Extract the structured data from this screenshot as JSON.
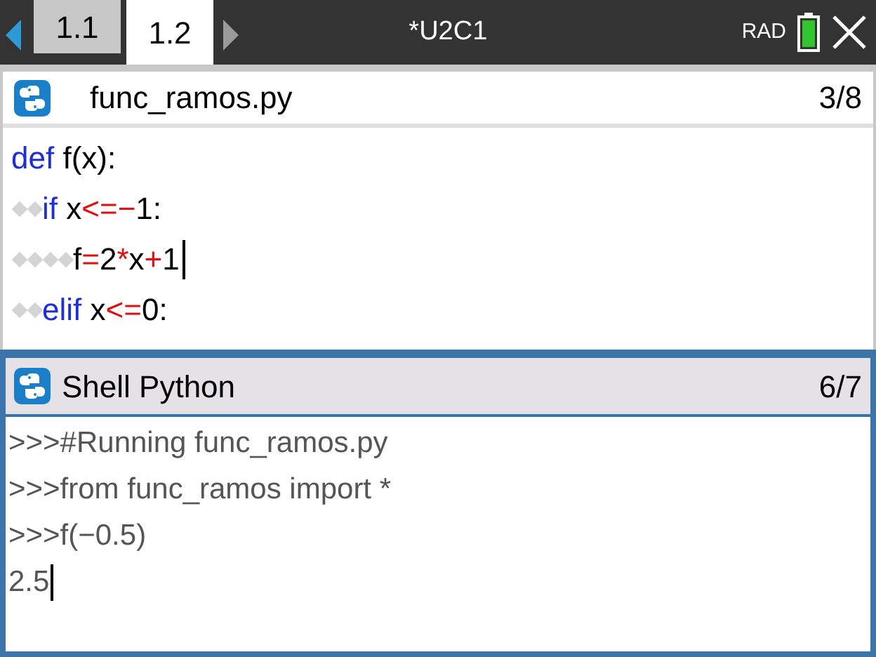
{
  "tabs": [
    {
      "label": "1.1",
      "selected": false
    },
    {
      "label": "1.2",
      "selected": true
    }
  ],
  "document_title": "*U2C1",
  "angle_mode": "RAD",
  "editor": {
    "file_name": "func_ramos.py",
    "position": "3/8",
    "lines": [
      {
        "cursor": false,
        "tokens": [
          {
            "kind": "keyword",
            "text": "def"
          },
          {
            "kind": "name",
            "text": " f(x):"
          }
        ],
        "children": [
          {
            "cursor": false,
            "tokens": [
              {
                "kind": "keyword",
                "text": "if"
              },
              {
                "kind": "name",
                "text": " x"
              },
              {
                "kind": "operator",
                "text": "<=−"
              },
              {
                "kind": "name",
                "text": "1:"
              }
            ],
            "children": [
              {
                "cursor": true,
                "tokens": [
                  {
                    "kind": "name",
                    "text": "f"
                  },
                  {
                    "kind": "operator",
                    "text": "="
                  },
                  {
                    "kind": "name",
                    "text": "2"
                  },
                  {
                    "kind": "operator",
                    "text": "*"
                  },
                  {
                    "kind": "name",
                    "text": "x"
                  },
                  {
                    "kind": "operator",
                    "text": "+"
                  },
                  {
                    "kind": "name",
                    "text": "1"
                  }
                ]
              }
            ]
          },
          {
            "cursor": false,
            "tokens": [
              {
                "kind": "keyword",
                "text": "elif"
              },
              {
                "kind": "name",
                "text": " x"
              },
              {
                "kind": "operator",
                "text": "<="
              },
              {
                "kind": "name",
                "text": "0:"
              }
            ]
          }
        ]
      }
    ]
  },
  "shell": {
    "title": "Shell Python",
    "position": "6/7",
    "lines": [
      {
        "text": ">>>#Running func_ramos.py",
        "cursor": false
      },
      {
        "text": ">>>from func_ramos import *",
        "cursor": false
      },
      {
        "text": ">>>f(−0.5)",
        "cursor": false
      },
      {
        "text": "2.5",
        "cursor": true
      }
    ]
  }
}
